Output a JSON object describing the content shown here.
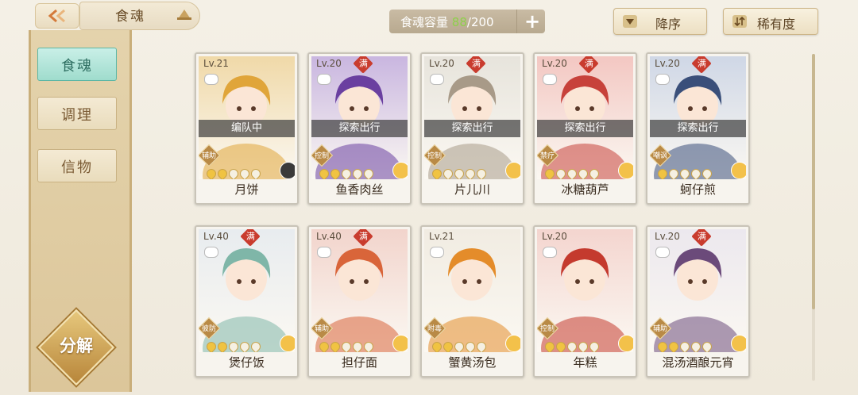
{
  "header": {
    "title": "食魂",
    "capacity_label": "食魂容量",
    "capacity_current": "88",
    "capacity_max": "/200",
    "add_label": "+",
    "sort_order": "降序",
    "sort_by": "稀有度"
  },
  "sidebar": {
    "tabs": [
      {
        "label": "食魂"
      },
      {
        "label": "调理"
      },
      {
        "label": "信物"
      }
    ],
    "decompose_label": "分解"
  },
  "cards": [
    {
      "level": "Lv.21",
      "full": "",
      "status": "编队中",
      "role": "辅助",
      "stars_on": 2,
      "name": "月饼",
      "art": "#f0d9a8",
      "accent": "#e0a53a"
    },
    {
      "level": "Lv.20",
      "full": "满",
      "status": "探索出行",
      "role": "控制",
      "stars_on": 2,
      "name": "鱼香肉丝",
      "art": "#c9b6e0",
      "accent": "#6a3fa0"
    },
    {
      "level": "Lv.20",
      "full": "满",
      "status": "探索出行",
      "role": "控制",
      "stars_on": 1,
      "name": "片儿川",
      "art": "#e7e4dc",
      "accent": "#a89a88"
    },
    {
      "level": "Lv.20",
      "full": "满",
      "status": "探索出行",
      "role": "禁疗",
      "stars_on": 1,
      "name": "冰糖葫芦",
      "art": "#f3c7c2",
      "accent": "#c7423b"
    },
    {
      "level": "Lv.20",
      "full": "满",
      "status": "探索出行",
      "role": "嘲讽",
      "stars_on": 1,
      "name": "蚵仔煎",
      "art": "#cfd7e6",
      "accent": "#3a4f7a"
    },
    {
      "level": "Lv.40",
      "full": "满",
      "status": "",
      "role": "彼防",
      "stars_on": 2,
      "name": "煲仔饭",
      "art": "#e8ecef",
      "accent": "#7fb6a8"
    },
    {
      "level": "Lv.40",
      "full": "满",
      "status": "",
      "role": "辅助",
      "stars_on": 2,
      "name": "担仔面",
      "art": "#f2d4cc",
      "accent": "#d9653a"
    },
    {
      "level": "Lv.21",
      "full": "",
      "status": "",
      "role": "附毒",
      "stars_on": 2,
      "name": "蟹黄汤包",
      "art": "#f1ece2",
      "accent": "#e48c2a"
    },
    {
      "level": "Lv.20",
      "full": "",
      "status": "",
      "role": "控制",
      "stars_on": 2,
      "name": "年糕",
      "art": "#f4d5cf",
      "accent": "#c43a2e"
    },
    {
      "level": "Lv.20",
      "full": "满",
      "status": "",
      "role": "辅助",
      "stars_on": 2,
      "name": "混汤酒酿元宵",
      "art": "#ece8ee",
      "accent": "#6b4a7a"
    }
  ],
  "icons": {
    "back": "back-arrow-icon",
    "title_icon": "hat-icon",
    "sort_order_icon": "triangle-down-icon",
    "sort_by_icon": "sort-arrows-icon",
    "rarity_flower": "flower-icon"
  },
  "colors": {
    "active_tab": "#9fdccd",
    "capacity_highlight": "#8ed04a",
    "full_badge": "#c93c2e",
    "star_on": "#f0c342"
  }
}
